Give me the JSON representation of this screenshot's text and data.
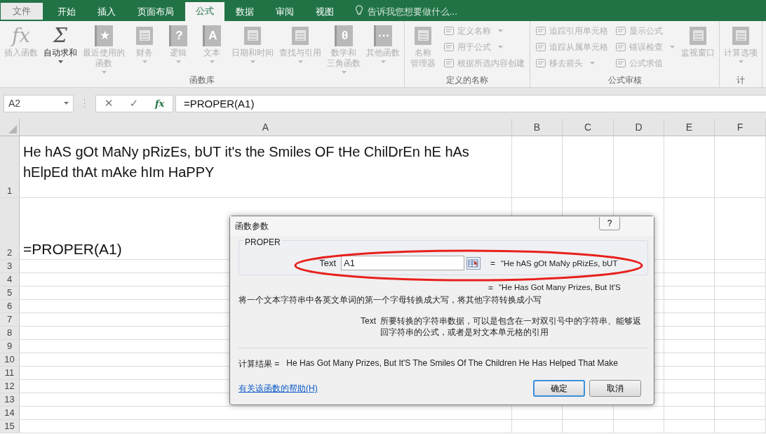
{
  "tabs": [
    {
      "label": "文件",
      "kind": "file",
      "selected": false
    },
    {
      "label": "开始",
      "kind": "tab",
      "selected": false
    },
    {
      "label": "插入",
      "kind": "tab",
      "selected": false
    },
    {
      "label": "页面布局",
      "kind": "tab",
      "selected": false
    },
    {
      "label": "公式",
      "kind": "tab",
      "selected": true
    },
    {
      "label": "数据",
      "kind": "tab",
      "selected": false
    },
    {
      "label": "审阅",
      "kind": "tab",
      "selected": false
    },
    {
      "label": "视图",
      "kind": "tab",
      "selected": false
    }
  ],
  "tell_me": {
    "placeholder": "告诉我您想要做什么..."
  },
  "ribbon_groups": [
    {
      "label": "函数库",
      "items": [
        {
          "kind": "glyph",
          "glyph": "fx",
          "label": "插入函数",
          "dropdown": false,
          "disabled": true
        },
        {
          "kind": "glyph",
          "glyph": "Σ",
          "label": "自动求和",
          "dropdown": true,
          "disabled": false
        },
        {
          "kind": "book",
          "glyph": "★",
          "label_lines": [
            "最近使用的",
            "函数"
          ],
          "dropdown": true,
          "disabled": true
        },
        {
          "kind": "tool",
          "label": "财务",
          "dropdown": true,
          "disabled": true
        },
        {
          "kind": "book",
          "glyph": "?",
          "label": "逻辑",
          "dropdown": true,
          "disabled": true
        },
        {
          "kind": "book",
          "glyph": "A",
          "label": "文本",
          "dropdown": true,
          "disabled": true
        },
        {
          "kind": "tool",
          "label": "日期和时间",
          "dropdown": true,
          "disabled": true
        },
        {
          "kind": "tool",
          "label": "查找与引用",
          "dropdown": true,
          "disabled": true
        },
        {
          "kind": "book",
          "glyph": "θ",
          "label_lines": [
            "数学和",
            "三角函数"
          ],
          "dropdown": true,
          "disabled": true
        },
        {
          "kind": "book",
          "glyph": "···",
          "label": "其他函数",
          "dropdown": true,
          "disabled": true
        }
      ]
    },
    {
      "label": "定义的名称",
      "items": [
        {
          "kind": "tool",
          "label_lines": [
            "名称",
            "管理器"
          ],
          "dropdown": false,
          "disabled": true
        },
        {
          "kind": "small",
          "label": "定义名称",
          "dropdown": true,
          "disabled": true
        },
        {
          "kind": "small",
          "label": "用于公式",
          "dropdown": true,
          "disabled": true
        },
        {
          "kind": "small",
          "label": "根据所选内容创建",
          "dropdown": false,
          "disabled": true
        }
      ]
    },
    {
      "label": "公式审核",
      "items": [
        {
          "kind": "small",
          "label": "追踪引用单元格",
          "dropdown": false,
          "disabled": true
        },
        {
          "kind": "small",
          "label": "追踪从属单元格",
          "dropdown": false,
          "disabled": true
        },
        {
          "kind": "small",
          "label": "移去箭头",
          "dropdown": true,
          "disabled": true
        },
        {
          "kind": "small",
          "label": "显示公式",
          "dropdown": false,
          "disabled": true
        },
        {
          "kind": "small",
          "label": "错误检查",
          "dropdown": true,
          "disabled": true
        },
        {
          "kind": "small",
          "label": "公式求值",
          "dropdown": false,
          "disabled": true
        },
        {
          "kind": "tool",
          "label": "监视窗口",
          "dropdown": false,
          "disabled": true
        }
      ]
    },
    {
      "label": "计",
      "items": [
        {
          "kind": "tool",
          "label": "计算选项",
          "dropdown": true,
          "disabled": true
        }
      ]
    }
  ],
  "formula_bar": {
    "name_box": "A2",
    "cancel": "✕",
    "enter": "✓",
    "fx": "fx",
    "formula": "=PROPER(A1)"
  },
  "columns": [
    "A",
    "B",
    "C",
    "D",
    "E",
    "F"
  ],
  "rows": [
    {
      "number": "1",
      "kind": "tall",
      "cell_a": "He hAS gOt MaNy pRizEs, bUT it's the Smiles OF tHe ChilDrEn hE hAs hElpEd thAt mAke hIm HaPPY"
    },
    {
      "number": "2",
      "kind": "tall",
      "cell_a": "=PROPER(A1)"
    },
    {
      "number": "3",
      "kind": "normal"
    },
    {
      "number": "4",
      "kind": "normal"
    },
    {
      "number": "5",
      "kind": "normal"
    },
    {
      "number": "6",
      "kind": "normal"
    },
    {
      "number": "7",
      "kind": "normal"
    },
    {
      "number": "8",
      "kind": "normal"
    },
    {
      "number": "9",
      "kind": "normal"
    },
    {
      "number": "10",
      "kind": "normal"
    },
    {
      "number": "11",
      "kind": "normal"
    },
    {
      "number": "12",
      "kind": "normal"
    },
    {
      "number": "13",
      "kind": "normal"
    },
    {
      "number": "14",
      "kind": "normal"
    },
    {
      "number": "15",
      "kind": "normal"
    }
  ],
  "dialog": {
    "title": "函数参数",
    "help": "?",
    "function_name": "PROPER",
    "arg_label": "Text",
    "arg_value": "A1",
    "arg_eq": "=",
    "arg_preview": "\"He hAS gOt MaNy pRizEs, bUT",
    "result_eq": "=",
    "result_preview": "\"He Has Got Many Prizes, But It'S",
    "description": "将一个文本字符串中各英文单词的第一个字母转换成大写，将其他字符转换成小写",
    "help_label": "Text",
    "help_text": "所要转换的字符串数据，可以是包含在一对双引号中的字符串、能够返回字符串的公式，或者是对文本单元格的引用",
    "result_label": "计算结果 =",
    "result": "He Has Got Many Prizes, But It'S The Smiles Of The Children He Has Helped That Make",
    "help_link": "有关该函数的帮助(H)",
    "buttons": [
      {
        "label": "确定",
        "default": true
      },
      {
        "label": "取消",
        "default": false
      }
    ]
  }
}
